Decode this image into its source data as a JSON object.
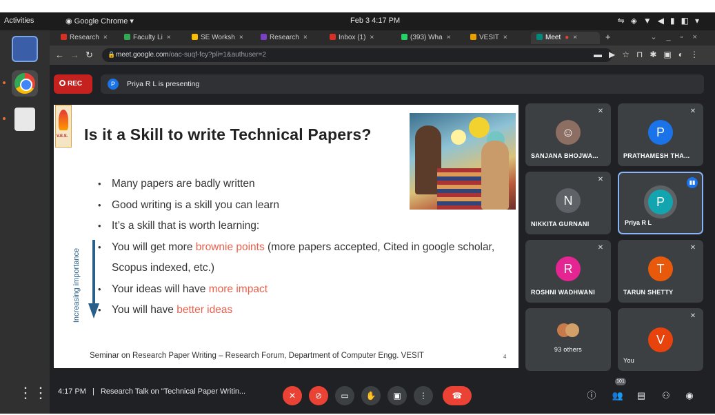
{
  "system_bar": {
    "activities": "Activities",
    "app_name": "Google Chrome ▾",
    "clock": "Feb 3  4:17 PM"
  },
  "browser": {
    "tabs": [
      {
        "label": "Research",
        "icon_color": "#d93025"
      },
      {
        "label": "Faculty Li",
        "icon_color": "#34a853"
      },
      {
        "label": "SE Worksh",
        "icon_color": "#fbbc05"
      },
      {
        "label": "Research",
        "icon_color": "#7b3fc6"
      },
      {
        "label": "Inbox (1)",
        "icon_color": "#d93025"
      },
      {
        "label": "(393) Wha",
        "icon_color": "#25d366"
      },
      {
        "label": "VESIT",
        "icon_color": "#e6a100"
      },
      {
        "label": "Meet",
        "icon_color": "#00897b"
      }
    ],
    "url_host": "meet.google.com",
    "url_path": "/oac-suqf-fcy?pli=1&authuser=2"
  },
  "meet": {
    "rec_label": "REC",
    "presenter_initial": "P",
    "presenting_text": "Priya R L is presenting",
    "slide": {
      "title": "Is it a Skill to write Technical Papers?",
      "logo_text": "V.E.S.",
      "bullets": [
        {
          "pre": "Many papers are badly written",
          "hl": "",
          "post": ""
        },
        {
          "pre": "Good writing is a skill you can learn",
          "hl": "",
          "post": ""
        },
        {
          "pre": "It’s a skill that is worth learning:",
          "hl": "",
          "post": ""
        },
        {
          "pre": "You will get more ",
          "hl": "brownie points",
          "post": " (more papers accepted, Cited in google scholar, Scopus indexed, etc.)"
        },
        {
          "pre": "Your ideas will have ",
          "hl": "more impact",
          "post": ""
        },
        {
          "pre": "You will have ",
          "hl": "better ideas",
          "post": ""
        }
      ],
      "arrow_label": "Increasing importance",
      "footer": "Seminar on Research Paper Writing – Research Forum, Department of Computer Engg. VESIT",
      "page_number": "4"
    },
    "participants": [
      {
        "name": "SANJANA BHOJWA...",
        "initial": "",
        "avatar_color": "#8d6e63",
        "muted": true
      },
      {
        "name": "PRATHAMESH THA...",
        "initial": "P",
        "avatar_color": "#1a73e8",
        "muted": true
      },
      {
        "name": "NIKKITA GURNANI",
        "initial": "N",
        "avatar_color": "#5f6368",
        "muted": true
      },
      {
        "name": "Priya R L",
        "initial": "P",
        "avatar_color": "#12a4af",
        "muted": false
      },
      {
        "name": "ROSHNI WADHWANI",
        "initial": "R",
        "avatar_color": "#e52592",
        "muted": true
      },
      {
        "name": "TARUN SHETTY",
        "initial": "T",
        "avatar_color": "#e8590c",
        "muted": true
      },
      {
        "name": "93 others",
        "initial": "",
        "avatar_color": "#5f6368",
        "muted": false
      },
      {
        "name": "You",
        "initial": "V",
        "avatar_color": "#e8430c",
        "muted": true
      }
    ],
    "toolbar": {
      "time": "4:17 PM",
      "separator": "|",
      "meeting_title": "Research Talk on \"Technical Paper Writin...",
      "people_count": "101"
    }
  }
}
